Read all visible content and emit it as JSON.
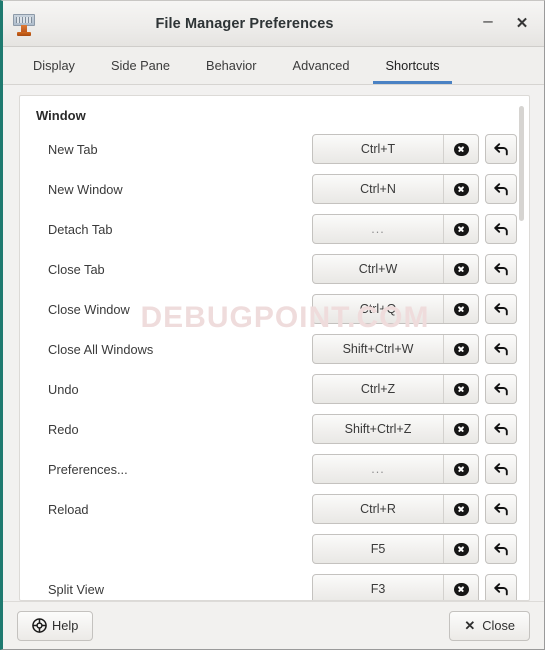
{
  "window": {
    "title": "File Manager Preferences",
    "icon": "file-manager-icon",
    "minimize_label": "–",
    "close_label": "✕"
  },
  "tabs": [
    {
      "label": "Display",
      "active": false
    },
    {
      "label": "Side Pane",
      "active": false
    },
    {
      "label": "Behavior",
      "active": false
    },
    {
      "label": "Advanced",
      "active": false
    },
    {
      "label": "Shortcuts",
      "active": true
    }
  ],
  "shortcuts": {
    "section_header": "Window",
    "rows": [
      {
        "label": "New Tab",
        "accel": "Ctrl+T",
        "placeholder": false
      },
      {
        "label": "New Window",
        "accel": "Ctrl+N",
        "placeholder": false
      },
      {
        "label": "Detach Tab",
        "accel": "...",
        "placeholder": true
      },
      {
        "label": "Close Tab",
        "accel": "Ctrl+W",
        "placeholder": false
      },
      {
        "label": "Close Window",
        "accel": "Ctrl+Q",
        "placeholder": false
      },
      {
        "label": "Close All Windows",
        "accel": "Shift+Ctrl+W",
        "placeholder": false
      },
      {
        "label": "Undo",
        "accel": "Ctrl+Z",
        "placeholder": false
      },
      {
        "label": "Redo",
        "accel": "Shift+Ctrl+Z",
        "placeholder": false
      },
      {
        "label": "Preferences...",
        "accel": "...",
        "placeholder": true
      },
      {
        "label": "Reload",
        "accel": "Ctrl+R",
        "placeholder": false
      },
      {
        "label": "",
        "accel": "F5",
        "placeholder": false
      },
      {
        "label": "Split View",
        "accel": "F3",
        "placeholder": false
      }
    ],
    "clear_icon": "clear-x-icon",
    "revert_icon": "undo-arrow-icon"
  },
  "watermark": {
    "text": "DEBUGPOINT.COM",
    "color": "#efdcdc"
  },
  "actionbar": {
    "help_label": "Help",
    "help_icon": "lifebuoy-help-icon",
    "close_label": "Close",
    "close_icon": "close-x-icon"
  },
  "colors": {
    "accent_tab_underline": "#4a82c4",
    "window_edge": "#1f7a70",
    "titlebar_bg": "#efeeec",
    "panel_bg": "#ffffff"
  }
}
